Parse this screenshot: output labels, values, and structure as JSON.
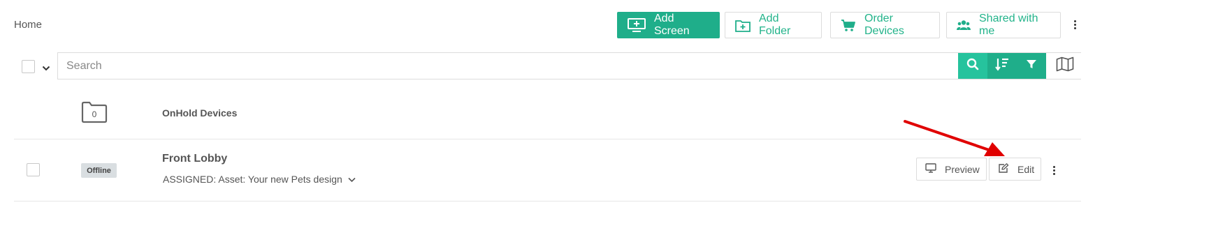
{
  "breadcrumb": "Home",
  "toolbar": {
    "add_screen": "Add Screen",
    "add_folder": "Add Folder",
    "order_devices": "Order Devices",
    "shared_with_me": "Shared with me"
  },
  "search": {
    "placeholder": "Search"
  },
  "folder": {
    "name": "OnHold Devices",
    "count": "0"
  },
  "screen": {
    "name": "Front Lobby",
    "status": "Offline",
    "assigned": "ASSIGNED: Asset: Your new Pets design",
    "preview_label": "Preview",
    "edit_label": "Edit"
  },
  "colors": {
    "accent": "#1fae8a",
    "annotation_arrow": "#e00000"
  },
  "icons": [
    "monitor-plus-icon",
    "folder-plus-icon",
    "cart-icon",
    "users-icon",
    "kebab-icon",
    "chevron-down-icon",
    "search-icon",
    "sort-icon",
    "filter-icon",
    "map-icon",
    "folder-icon",
    "monitor-icon",
    "edit-icon"
  ]
}
